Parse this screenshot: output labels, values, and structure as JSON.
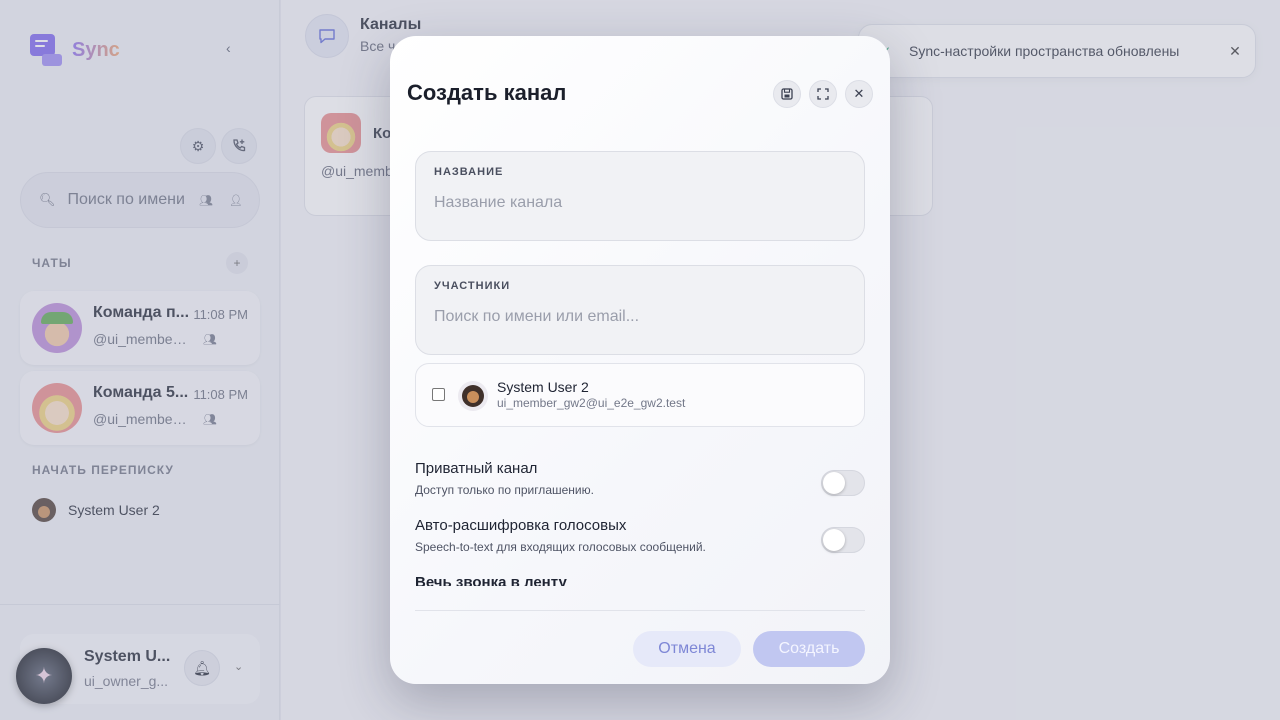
{
  "colors": {
    "accent": "#7a63f0",
    "overlay": "rgba(160,164,182,0.36)",
    "primary_button": "#c1c7f1",
    "success": "#1aa36a"
  },
  "sidebar": {
    "app_name": "Sync",
    "collapse_icon": "chevron-left-icon",
    "settings_icon": "gear-icon",
    "new_call_icon": "phone-plus-icon",
    "search_placeholder": "Поиск по имени",
    "chats_label": "ЧАТЫ",
    "chats": [
      {
        "name": "Команда п...",
        "time": "11:08 PM",
        "subtitle": "@ui_member_..."
      },
      {
        "name": "Команда 5...",
        "time": "11:08 PM",
        "subtitle": "@ui_member_..."
      }
    ],
    "start_label": "НАЧАТЬ ПЕРЕПИСКУ",
    "dm_user": "System User 2",
    "profile": {
      "name": "System U...",
      "subtitle": "ui_owner_g..."
    }
  },
  "main": {
    "title": "Каналы",
    "subtitle": "Все ч",
    "cards": [
      {
        "title": "Ко",
        "subtitle": "@ui_memb"
      }
    ]
  },
  "toast": {
    "message": "Sync-настройки пространства обновлены"
  },
  "modal": {
    "title": "Создать канал",
    "name_field": {
      "label": "НАЗВАНИЕ",
      "placeholder": "Название канала",
      "value": ""
    },
    "members_field": {
      "label": "УЧАСТНИКИ",
      "placeholder": "Поиск по имени или email...",
      "value": ""
    },
    "member": {
      "name": "System User 2",
      "email": "ui_member_gw2@ui_e2e_gw2.test",
      "checked": false
    },
    "options": [
      {
        "title": "Приватный канал",
        "description": "Доступ только по приглашению.",
        "enabled": false
      },
      {
        "title": "Авто-расшифровка голосовых",
        "description": "Speech-to-text для входящих голосовых сообщений.",
        "enabled": false
      }
    ],
    "cut_option": "Вечь звонка в ленту",
    "cancel_label": "Отмена",
    "create_label": "Создать"
  }
}
